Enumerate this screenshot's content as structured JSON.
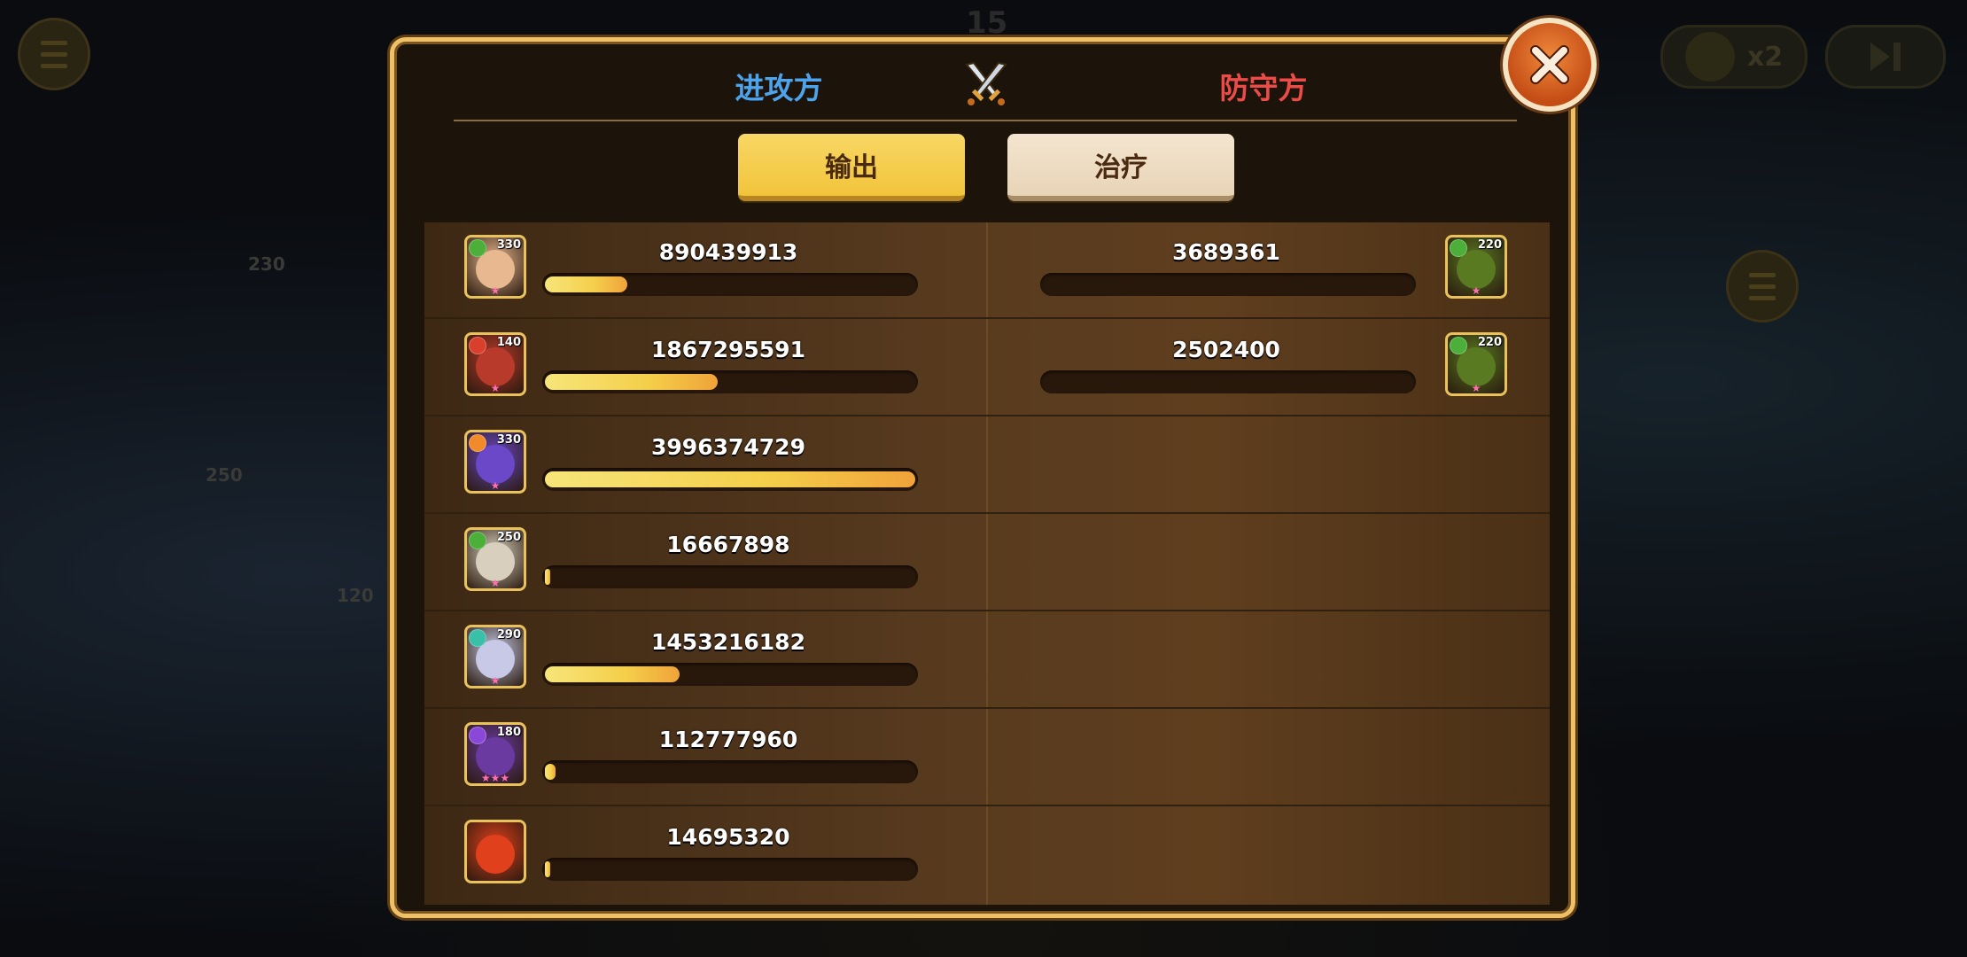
{
  "background": {
    "round_number": "15",
    "speed_label": "x2",
    "side_numbers": [
      "230",
      "250",
      "120"
    ]
  },
  "header": {
    "attacker_label": "进攻方",
    "defender_label": "防守方",
    "crossed_swords_icon": "crossed-swords-icon"
  },
  "tabs": {
    "output_label": "输出",
    "heal_label": "治疗",
    "active": "output"
  },
  "colors": {
    "attacker": "#4da4ec",
    "defender": "#ec4c48",
    "bar_fill": "#f4cf4a",
    "panel_border": "#f0c067"
  },
  "attackers": [
    {
      "level": "330",
      "value": "890439913",
      "fraction": 0.223,
      "element": "green",
      "stars": "★"
    },
    {
      "level": "140",
      "value": "1867295591",
      "fraction": 0.467,
      "element": "red",
      "stars": "★"
    },
    {
      "level": "330",
      "value": "3996374729",
      "fraction": 1.0,
      "element": "orange",
      "stars": "★"
    },
    {
      "level": "250",
      "value": "16667898",
      "fraction": 0.004,
      "element": "green",
      "stars": "★"
    },
    {
      "level": "290",
      "value": "1453216182",
      "fraction": 0.364,
      "element": "teal",
      "stars": "★"
    },
    {
      "level": "180",
      "value": "112777960",
      "fraction": 0.028,
      "element": "purple",
      "stars": "★★★"
    },
    {
      "level": "",
      "value": "14695320",
      "fraction": 0.004,
      "element": "",
      "stars": ""
    }
  ],
  "defenders": [
    {
      "level": "220",
      "value": "3689361",
      "fraction": 0.0,
      "element": "green",
      "stars": "★"
    },
    {
      "level": "220",
      "value": "2502400",
      "fraction": 0.0,
      "element": "green",
      "stars": "★"
    }
  ]
}
